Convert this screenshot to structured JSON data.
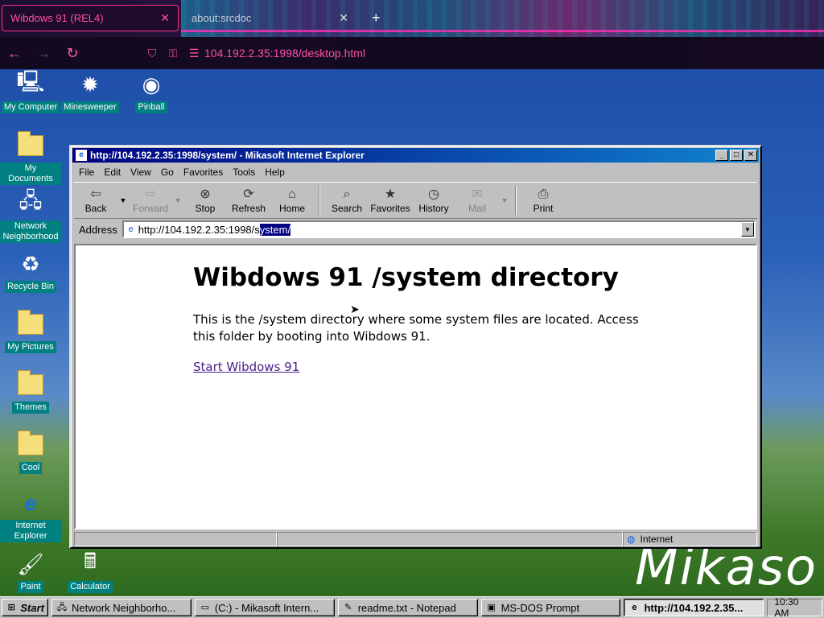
{
  "browser": {
    "tabs": [
      {
        "title": "Wibdows 91 (REL4)",
        "active": true
      },
      {
        "title": "about:srcdoc",
        "active": false
      }
    ],
    "url": "104.192.2.35:1998/desktop.html"
  },
  "desktop": {
    "icons": [
      {
        "label": "My Computer",
        "icon": "computer-icon"
      },
      {
        "label": "Minesweeper",
        "icon": "mine-icon"
      },
      {
        "label": "Pinball",
        "icon": "pinball-icon"
      },
      {
        "label": "My Documents",
        "icon": "folder-icon"
      },
      {
        "label": "Network Neighborhood",
        "icon": "network-icon"
      },
      {
        "label": "Recycle Bin",
        "icon": "recycle-bin-icon"
      },
      {
        "label": "My Pictures",
        "icon": "folder-icon"
      },
      {
        "label": "Themes",
        "icon": "folder-icon"
      },
      {
        "label": "Cool",
        "icon": "folder-icon"
      },
      {
        "label": "Internet Explorer",
        "icon": "ie-icon"
      },
      {
        "label": "Paint",
        "icon": "paint-icon"
      },
      {
        "label": "Calculator",
        "icon": "calculator-icon"
      }
    ],
    "watermark": "Mikaso"
  },
  "ie": {
    "title": "http://104.192.2.35:1998/system/ - Mikasoft Internet Explorer",
    "menu": [
      "File",
      "Edit",
      "View",
      "Go",
      "Favorites",
      "Tools",
      "Help"
    ],
    "toolbar": {
      "back": "Back",
      "forward": "Forward",
      "stop": "Stop",
      "refresh": "Refresh",
      "home": "Home",
      "search": "Search",
      "favorites": "Favorites",
      "history": "History",
      "mail": "Mail",
      "print": "Print"
    },
    "address_label": "Address",
    "address_prefix": "http://104.192.2.35:1998/s",
    "address_selected": "ystem/",
    "page": {
      "heading": "Wibdows 91 /system directory",
      "body": "This is the /system directory where some system files are located. Access this folder by booting into Wibdows 91.",
      "link": "Start Wibdows 91"
    },
    "status_zone": "Internet"
  },
  "taskbar": {
    "start": "Start",
    "items": [
      "Network Neighborho...",
      "(C:) - Mikasoft Intern...",
      "readme.txt - Notepad",
      "MS-DOS Prompt",
      "http://104.192.2.35..."
    ],
    "clock": "10:30 AM"
  }
}
